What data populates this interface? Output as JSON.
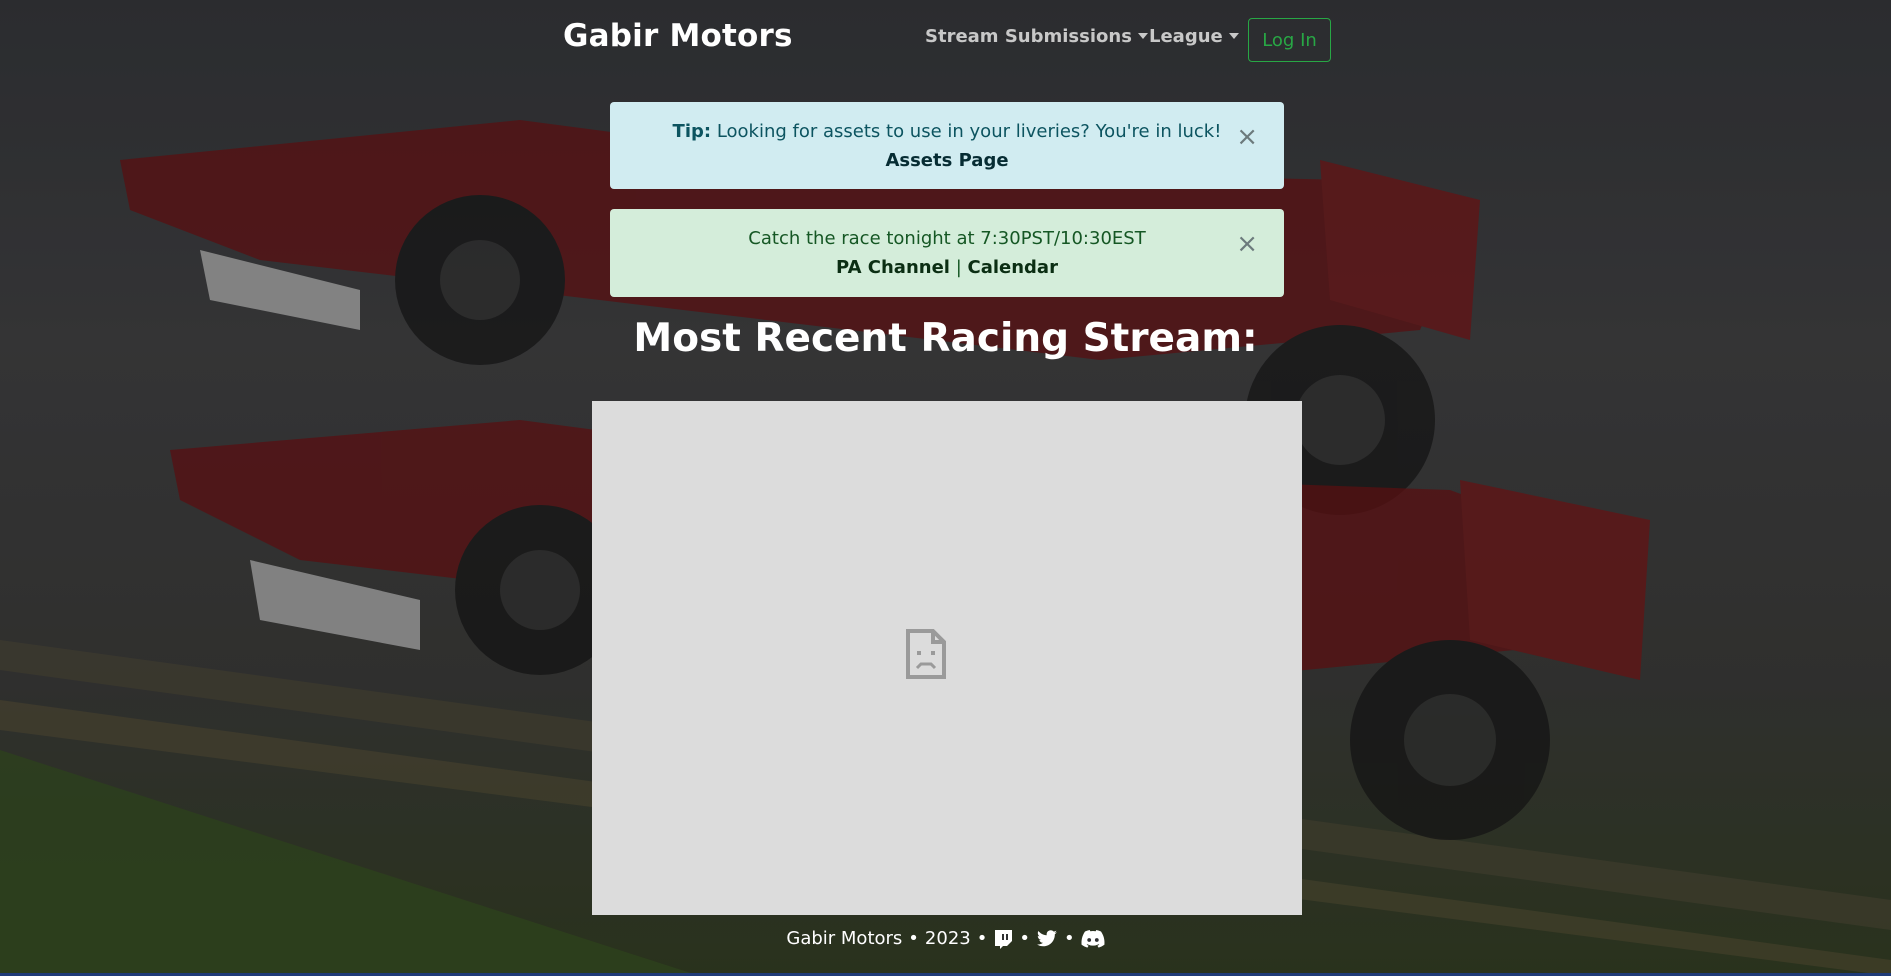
{
  "nav": {
    "brand": "Gabir Motors",
    "stream_submissions": "Stream Submissions",
    "league": "League",
    "login": "Log In"
  },
  "alerts": {
    "tip": {
      "label": "Tip:",
      "text": "Looking for assets to use in your liveries? You're in luck!",
      "link": "Assets Page",
      "close": "×"
    },
    "race": {
      "text": "Catch the race tonight at 7:30PST/10:30EST",
      "link_channel": "PA Channel",
      "separator": "|",
      "link_calendar": "Calendar",
      "close": "×"
    }
  },
  "main": {
    "title": "Most Recent Racing Stream:"
  },
  "footer": {
    "brand": "Gabir Motors",
    "bullet": "•",
    "year": "2023"
  },
  "icons": {
    "sad_page": "sad-page-icon",
    "twitch": "twitch-icon",
    "twitter": "twitter-icon",
    "discord": "discord-icon"
  },
  "colors": {
    "login_border": "#28a745",
    "alert_info_bg": "#d1ecf1",
    "alert_success_bg": "#d4edda",
    "frame_bg": "#dcdcdc"
  }
}
